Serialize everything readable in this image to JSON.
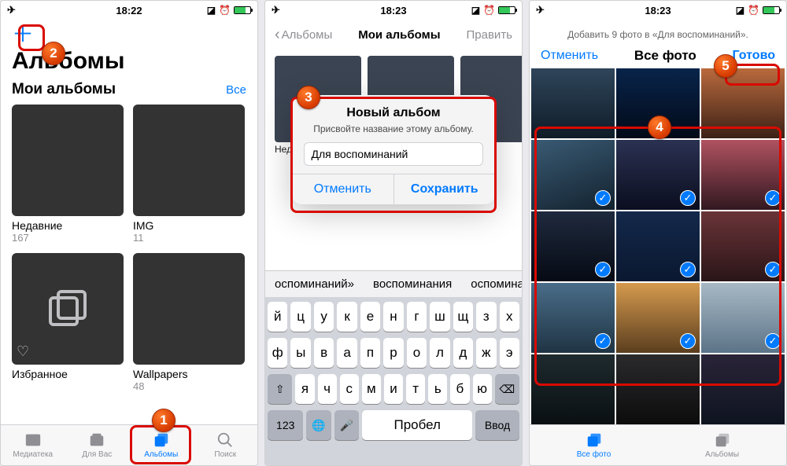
{
  "status": {
    "time1": "18:22",
    "time2": "18:23",
    "time3": "18:23"
  },
  "screen1": {
    "title": "Альбомы",
    "sectionTitle": "Мои альбомы",
    "seeAll": "Все",
    "albums": [
      {
        "name": "Недавние",
        "count": "167"
      },
      {
        "name": "IMG",
        "count": "11"
      },
      {
        "name": "Избранное",
        "count": ""
      },
      {
        "name": "Wallpapers",
        "count": "48"
      }
    ],
    "tabs": {
      "library": "Медиатека",
      "forYou": "Для Вас",
      "albums": "Альбомы",
      "search": "Поиск"
    }
  },
  "screen2": {
    "back": "Альбомы",
    "title": "Мои альбомы",
    "edit": "Править",
    "albumPreview": "Неда",
    "modal": {
      "title": "Новый альбом",
      "subtitle": "Присвойте название этому альбому.",
      "value": "Для воспоминаний",
      "cancel": "Отменить",
      "save": "Сохранить"
    },
    "candidates": [
      "оспоминаний»",
      "воспоминания",
      "оспоминание"
    ],
    "keyboard": {
      "row1": [
        "й",
        "ц",
        "у",
        "к",
        "е",
        "н",
        "г",
        "ш",
        "щ",
        "з",
        "х"
      ],
      "row2": [
        "ф",
        "ы",
        "в",
        "а",
        "п",
        "р",
        "о",
        "л",
        "д",
        "ж",
        "э"
      ],
      "row3": [
        "⇧",
        "я",
        "ч",
        "с",
        "м",
        "и",
        "т",
        "ь",
        "б",
        "ю",
        "⌫"
      ],
      "row4": {
        "n": "123",
        "globe": "🌐",
        "mic": "🎤",
        "space": "Пробел",
        "enter": "Ввод"
      }
    }
  },
  "screen3": {
    "header": "Добавить 9 фото в «Для воспоминаний».",
    "cancel": "Отменить",
    "title": "Все фото",
    "done": "Готово",
    "tabs": {
      "all": "Все фото",
      "albums": "Альбомы"
    }
  },
  "callouts": {
    "1": "1",
    "2": "2",
    "3": "3",
    "4": "4",
    "5": "5"
  }
}
